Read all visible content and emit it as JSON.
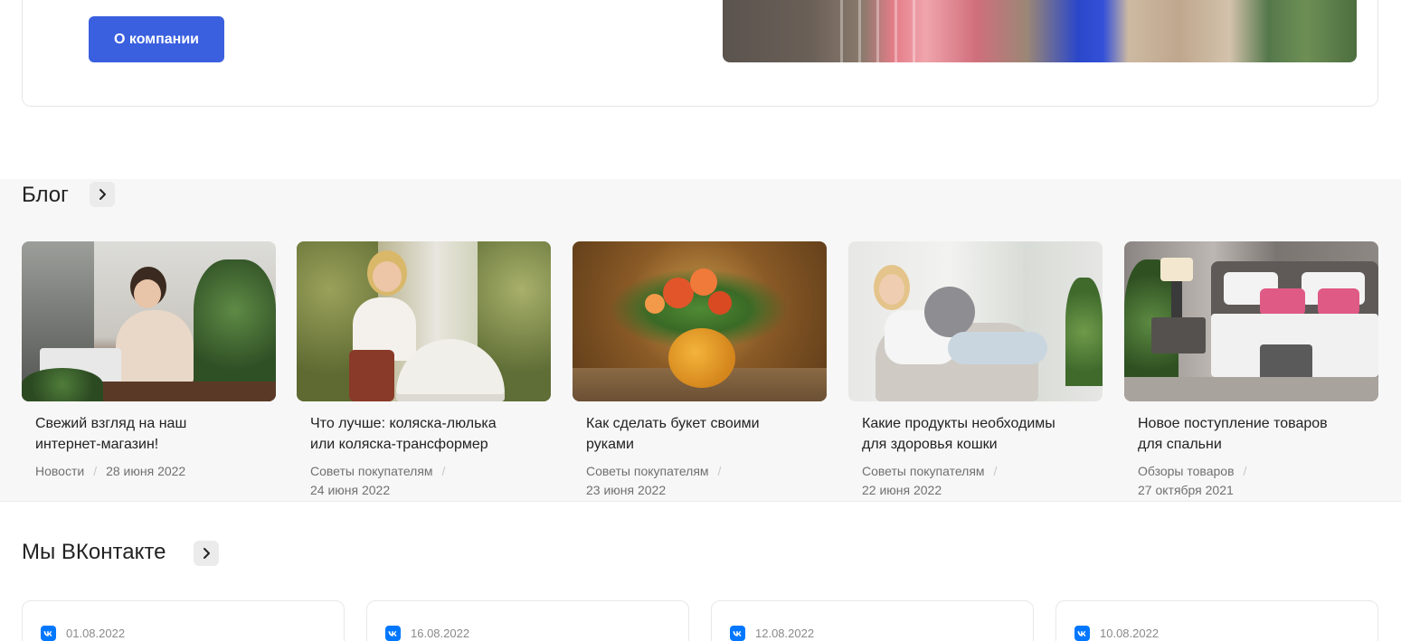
{
  "about": {
    "button_label": "О компании"
  },
  "blog": {
    "title": "Блог",
    "posts": [
      {
        "title": "Свежий взгляд на наш\nинтернет-магазин!",
        "category": "Новости",
        "date": "28 июня 2022"
      },
      {
        "title": "Что лучше: коляска-люлька\nили коляска-трансформер",
        "category": "Советы покупателям",
        "date": "24 июня 2022"
      },
      {
        "title": "Как сделать букет своими\nруками",
        "category": "Советы покупателям",
        "date": "23 июня 2022"
      },
      {
        "title": "Какие продукты необходимы\nдля здоровья кошки",
        "category": "Советы покупателям",
        "date": "22 июня 2022"
      },
      {
        "title": "Новое поступление товаров\nдля спальни",
        "category": "Обзоры товаров",
        "date": "27 октября 2021"
      }
    ]
  },
  "vk": {
    "title": "Мы ВКонтакте",
    "posts": [
      {
        "date": "01.08.2022"
      },
      {
        "date": "16.08.2022"
      },
      {
        "date": "12.08.2022"
      },
      {
        "date": "10.08.2022"
      }
    ]
  },
  "colors": {
    "accent": "#3a5fdf",
    "vk_brand": "#0077ff",
    "blog_bg": "#f7f7f7"
  },
  "icons": {
    "section_arrow": "chevron-right-icon",
    "vk": "vk-logo-icon"
  }
}
